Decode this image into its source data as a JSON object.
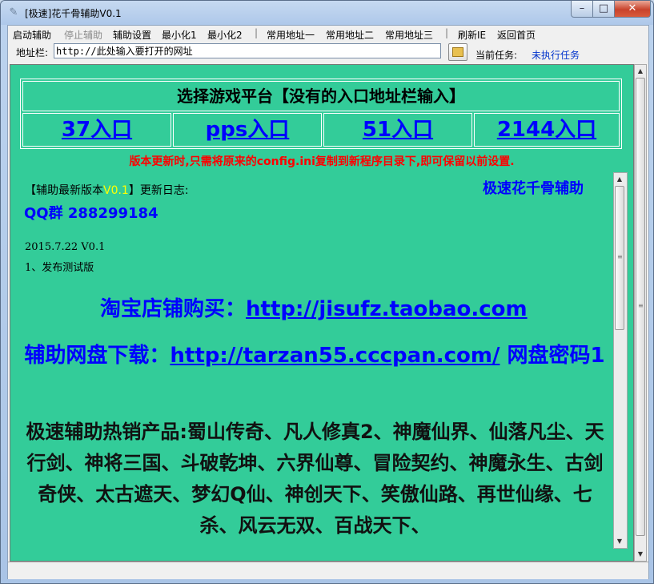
{
  "window": {
    "title": "[极速]花千骨辅助V0.1",
    "icon": "app-logo-icon",
    "controls": {
      "minimize": "–",
      "maximize": "□",
      "close": "✕"
    }
  },
  "menu": {
    "items": [
      {
        "label": "启动辅助",
        "enabled": true
      },
      {
        "label": "停止辅助",
        "enabled": false
      },
      {
        "label": "辅助设置",
        "enabled": true
      },
      {
        "label": "最小化1",
        "enabled": true
      },
      {
        "label": "最小化2",
        "enabled": true
      },
      {
        "label": "常用地址一",
        "enabled": true
      },
      {
        "label": "常用地址二",
        "enabled": true
      },
      {
        "label": "常用地址三",
        "enabled": true
      },
      {
        "label": "刷新IE",
        "enabled": true
      },
      {
        "label": "返回首页",
        "enabled": true
      }
    ],
    "separator": "|"
  },
  "address_bar": {
    "label": "地址栏:",
    "value": "http://此处输入要打开的网址",
    "go_icon": "folder-go-icon"
  },
  "task": {
    "label": "当前任务:",
    "value": "未执行任务"
  },
  "platform_table": {
    "header": "选择游戏平台【没有的入口地址栏输入】",
    "entries": [
      "37入口",
      "pps入口",
      "51入口",
      "2144入口"
    ]
  },
  "notice": "版本更新时,只需将原来的config.ini复制到新程序目录下,即可保留以前设置.",
  "changelog": {
    "prefix": "【辅助最新版本",
    "version": "V0.1",
    "suffix": "】更新日志:",
    "brand": "极速花千骨辅助",
    "qq": "QQ群 288299184",
    "entries": [
      "2015.7.22 V0.1",
      "1、发布测试版"
    ]
  },
  "taobao": {
    "label": "淘宝店铺购买：",
    "url": "http://jisufz.taobao.com"
  },
  "netdisk": {
    "label": "辅助网盘下载：",
    "url": "http://tarzan55.cccpan.com/",
    "password_text": " 网盘密码1"
  },
  "products_text": "极速辅助热销产品:蜀山传奇、凡人修真2、神魔仙界、仙落凡尘、天行剑、神将三国、斗破乾坤、六界仙尊、冒险契约、神魔永生、古剑奇侠、太古遮天、梦幻Q仙、神创天下、笑傲仙路、再世仙缘、七杀、风云无双、百战天下、",
  "colors": {
    "content_bg": "#33cc99",
    "link_blue": "#0000ff",
    "notice_red": "#ff0000",
    "version_yellow": "#ffff00"
  }
}
